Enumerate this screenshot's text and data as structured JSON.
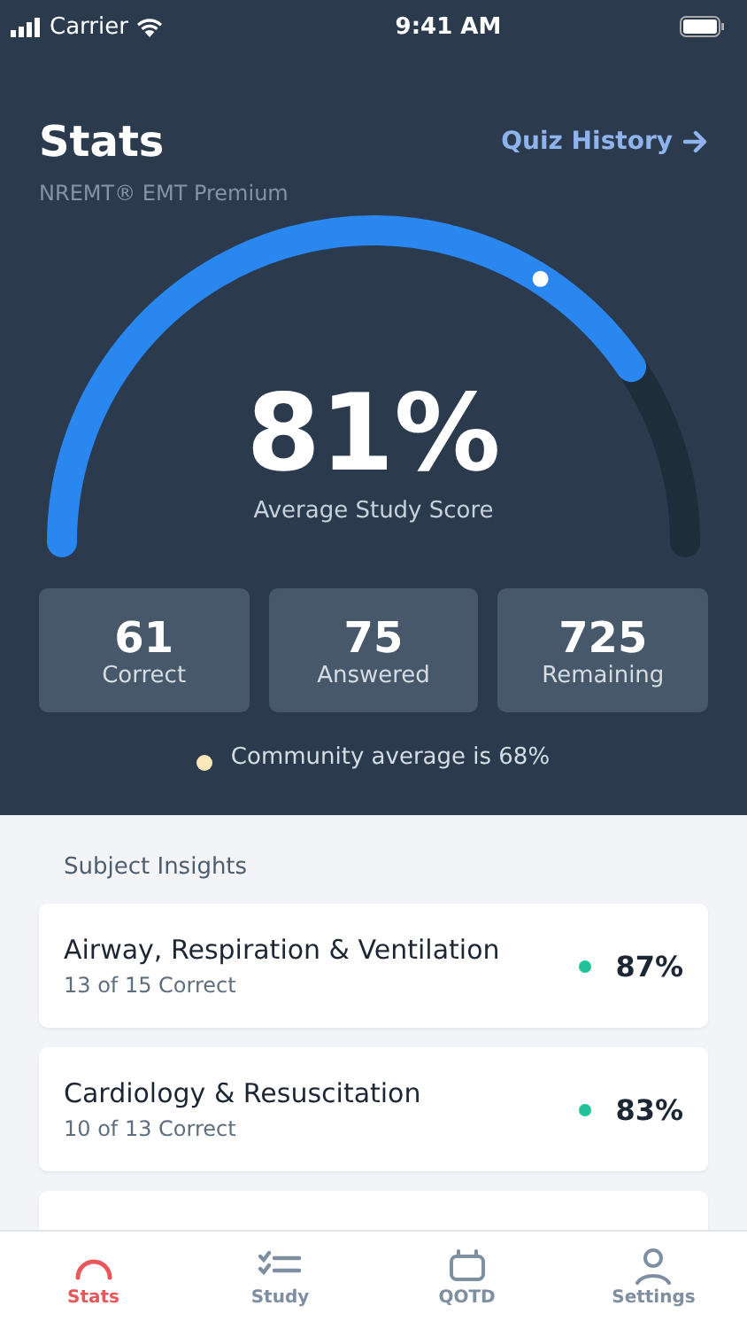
{
  "status_bar": {
    "carrier": "Carrier",
    "time": "9:41 AM"
  },
  "header": {
    "title": "Stats",
    "subtitle": "NREMT® EMT Premium",
    "link": "Quiz History"
  },
  "gauge": {
    "value": "81%",
    "label": "Average Study Score"
  },
  "counts": [
    {
      "value": "61",
      "label": "Correct"
    },
    {
      "value": "75",
      "label": "Answered"
    },
    {
      "value": "725",
      "label": "Remaining"
    }
  ],
  "community": {
    "text": "Community average is 68%"
  },
  "insights": {
    "heading": "Subject Insights",
    "items": [
      {
        "title": "Airway, Respiration & Ventilation",
        "detail": "13 of 15 Correct",
        "percent": "87%",
        "color": "#1fc29a"
      },
      {
        "title": "Cardiology & Resuscitation",
        "detail": "10 of 13 Correct",
        "percent": "83%",
        "color": "#1fc29a"
      }
    ]
  },
  "tabs": [
    {
      "label": "Stats",
      "selected": true
    },
    {
      "label": "Study",
      "selected": false
    },
    {
      "label": "QOTD",
      "selected": false
    },
    {
      "label": "Settings",
      "selected": false
    }
  ]
}
